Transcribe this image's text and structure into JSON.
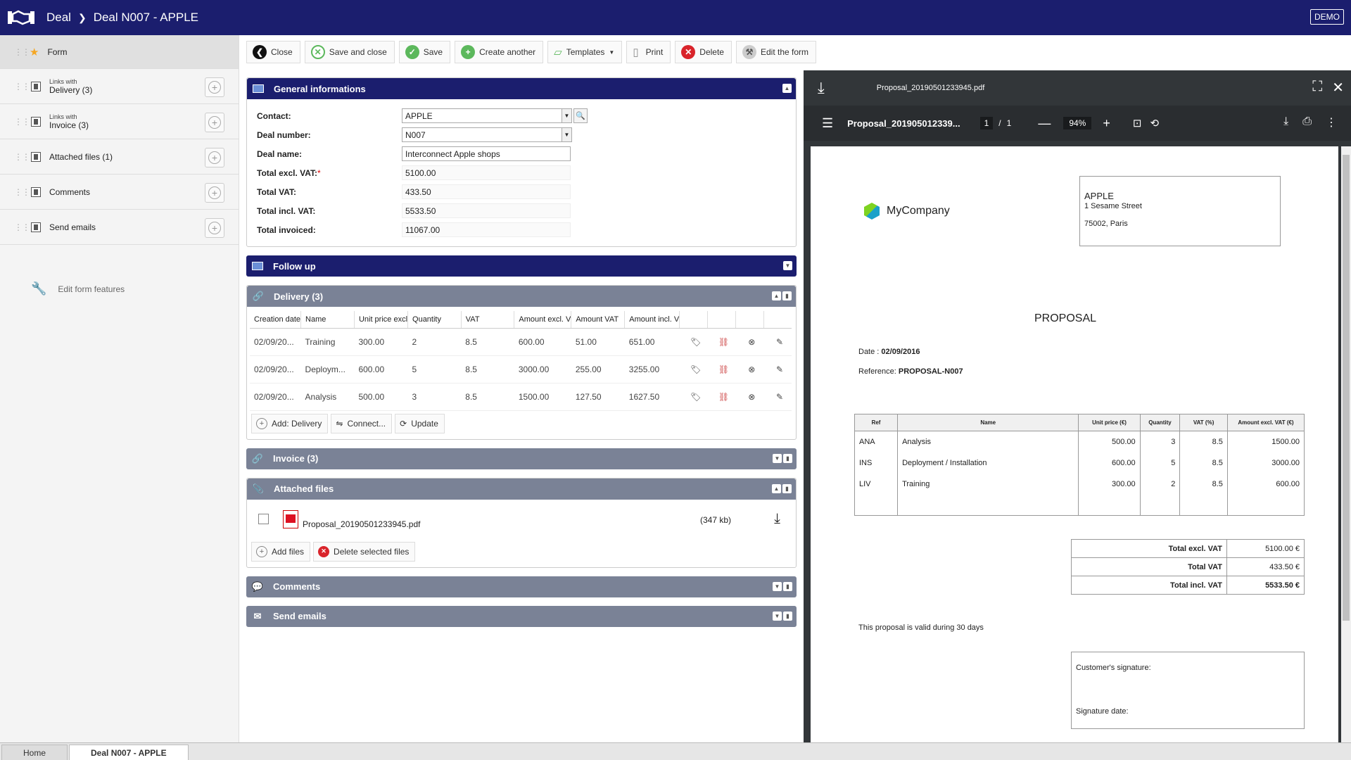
{
  "header": {
    "crumb_root": "Deal",
    "crumb_current": "Deal N007 - APPLE",
    "demo": "DEMO"
  },
  "sidebar": {
    "form_label": "Form",
    "items": [
      {
        "small": "Links with",
        "big": "Delivery (3)"
      },
      {
        "small": "Links with",
        "big": "Invoice (3)"
      },
      {
        "label": "Attached files (1)"
      },
      {
        "label": "Comments"
      },
      {
        "label": "Send emails"
      }
    ],
    "edit_features": "Edit form features"
  },
  "toolbar": {
    "close": "Close",
    "save_close": "Save and close",
    "save": "Save",
    "create_another": "Create another",
    "templates": "Templates",
    "print": "Print",
    "delete": "Delete",
    "edit_form": "Edit the form"
  },
  "general": {
    "title": "General informations",
    "fields": {
      "contact_label": "Contact:",
      "contact_value": "APPLE",
      "deal_number_label": "Deal number:",
      "deal_number_value": "N007",
      "deal_name_label": "Deal name:",
      "deal_name_value": "Interconnect Apple shops",
      "total_excl_label": "Total excl. VAT:",
      "total_excl_required": "*",
      "total_excl_value": "5100.00",
      "total_vat_label": "Total VAT:",
      "total_vat_value": "433.50",
      "total_incl_label": "Total incl. VAT:",
      "total_incl_value": "5533.50",
      "total_invoiced_label": "Total invoiced:",
      "total_invoiced_value": "11067.00"
    }
  },
  "followup": {
    "title": "Follow up"
  },
  "delivery": {
    "title": "Delivery (3)",
    "columns": [
      "Creation date",
      "Name",
      "Unit price excl",
      "Quantity",
      "VAT",
      "Amount excl. V",
      "Amount VAT",
      "Amount incl. V"
    ],
    "rows": [
      [
        "02/09/20...",
        "Training",
        "300.00",
        "2",
        "8.5",
        "600.00",
        "51.00",
        "651.00"
      ],
      [
        "02/09/20...",
        "Deploym...",
        "600.00",
        "5",
        "8.5",
        "3000.00",
        "255.00",
        "3255.00"
      ],
      [
        "02/09/20...",
        "Analysis",
        "500.00",
        "3",
        "8.5",
        "1500.00",
        "127.50",
        "1627.50"
      ]
    ],
    "add": "Add: Delivery",
    "connect": "Connect...",
    "update": "Update"
  },
  "invoice": {
    "title": "Invoice (3)"
  },
  "attached": {
    "title": "Attached files",
    "file_name": "Proposal_20190501233945.pdf",
    "file_size": "(347 kb)",
    "add": "Add files",
    "delete": "Delete selected files"
  },
  "comments": {
    "title": "Comments"
  },
  "emails": {
    "title": "Send emails"
  },
  "viewer": {
    "file_name": "Proposal_20190501233945.pdf",
    "bar_title": "Proposal_201905012339...",
    "page": "1",
    "page_sep": "/",
    "page_total": "1",
    "zoom": "94%"
  },
  "pdf": {
    "company": "MyCompany",
    "addr_name": "APPLE",
    "addr_street": "1 Sesame Street",
    "addr_city": "75002, Paris",
    "title": "PROPOSAL",
    "date_label": "Date : ",
    "date_value": "02/09/2016",
    "ref_label": "Reference: ",
    "ref_value": "PROPOSAL-N007",
    "table_headers": [
      "Ref",
      "Name",
      "Unit price (€)",
      "Quantity",
      "VAT (%)",
      "Amount excl. VAT (€)"
    ],
    "table_rows": [
      [
        "ANA",
        "Analysis",
        "500.00",
        "3",
        "8.5",
        "1500.00"
      ],
      [
        "INS",
        "Deployment / Installation",
        "600.00",
        "5",
        "8.5",
        "3000.00"
      ],
      [
        "LIV",
        "Training",
        "300.00",
        "2",
        "8.5",
        "600.00"
      ]
    ],
    "totals": [
      {
        "label": "Total excl. VAT",
        "value": "5100.00 €"
      },
      {
        "label": "Total VAT",
        "value": "433.50 €"
      },
      {
        "label": "Total incl. VAT",
        "value": "5533.50 €"
      }
    ],
    "valid_text": "This proposal is valid during 30 days",
    "sig_customer": "Customer's signature:",
    "sig_date": "Signature date:"
  },
  "bottom": {
    "home": "Home",
    "deal": "Deal N007 - APPLE"
  },
  "colors": {
    "header": "#1b1e6e",
    "panel_gray": "#7a8296",
    "viewer_bg": "#323639"
  }
}
